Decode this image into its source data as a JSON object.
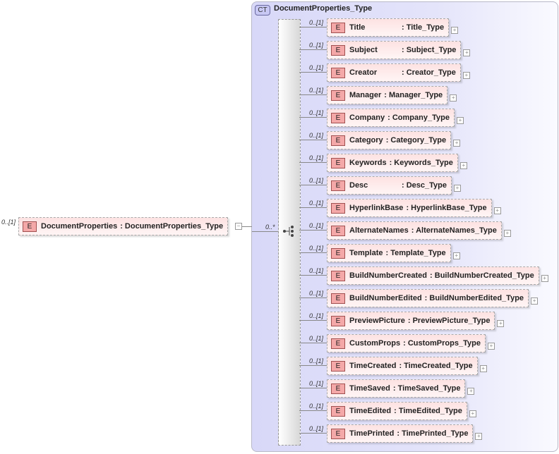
{
  "root": {
    "cardinality": "0..[1]",
    "badge": "E",
    "name": "DocumentProperties",
    "type": ": DocumentProperties_Type",
    "expander": "−"
  },
  "complex_type": {
    "badge": "CT",
    "name": "DocumentProperties_Type"
  },
  "sequence": {
    "cardinality": "0..*",
    "icon": "sequence-icon"
  },
  "children": [
    {
      "card": "0..[1]",
      "badge": "E",
      "name": "Title",
      "type": ": Title_Type",
      "exp": "+"
    },
    {
      "card": "0..[1]",
      "badge": "E",
      "name": "Subject",
      "type": ": Subject_Type",
      "exp": "+"
    },
    {
      "card": "0..[1]",
      "badge": "E",
      "name": "Creator",
      "type": ": Creator_Type",
      "exp": "+"
    },
    {
      "card": "0..[1]",
      "badge": "E",
      "name": "Manager",
      "type": ": Manager_Type",
      "exp": "+"
    },
    {
      "card": "0..[1]",
      "badge": "E",
      "name": "Company",
      "type": ": Company_Type",
      "exp": "+"
    },
    {
      "card": "0..[1]",
      "badge": "E",
      "name": "Category",
      "type": ": Category_Type",
      "exp": "+"
    },
    {
      "card": "0..[1]",
      "badge": "E",
      "name": "Keywords",
      "type": ": Keywords_Type",
      "exp": "+"
    },
    {
      "card": "0..[1]",
      "badge": "E",
      "name": "Desc",
      "type": ": Desc_Type",
      "exp": "+"
    },
    {
      "card": "0..[1]",
      "badge": "E",
      "name": "HyperlinkBase",
      "type": ": HyperlinkBase_Type",
      "exp": "+"
    },
    {
      "card": "0..[1]",
      "badge": "E",
      "name": "AlternateNames",
      "type": ": AlternateNames_Type",
      "exp": "+"
    },
    {
      "card": "0..[1]",
      "badge": "E",
      "name": "Template",
      "type": ": Template_Type",
      "exp": "+"
    },
    {
      "card": "0..[1]",
      "badge": "E",
      "name": "BuildNumberCreated",
      "type": ": BuildNumberCreated_Type",
      "exp": "+"
    },
    {
      "card": "0..[1]",
      "badge": "E",
      "name": "BuildNumberEdited",
      "type": ": BuildNumberEdited_Type",
      "exp": "+"
    },
    {
      "card": "0..[1]",
      "badge": "E",
      "name": "PreviewPicture",
      "type": ": PreviewPicture_Type",
      "exp": "+"
    },
    {
      "card": "0..[1]",
      "badge": "E",
      "name": "CustomProps",
      "type": ": CustomProps_Type",
      "exp": "+"
    },
    {
      "card": "0..[1]",
      "badge": "E",
      "name": "TimeCreated",
      "type": ": TimeCreated_Type",
      "exp": "+"
    },
    {
      "card": "0..[1]",
      "badge": "E",
      "name": "TimeSaved",
      "type": ": TimeSaved_Type",
      "exp": "+"
    },
    {
      "card": "0..[1]",
      "badge": "E",
      "name": "TimeEdited",
      "type": ": TimeEdited_Type",
      "exp": "+"
    },
    {
      "card": "0..[1]",
      "badge": "E",
      "name": "TimePrinted",
      "type": ": TimePrinted_Type",
      "exp": "+"
    }
  ]
}
